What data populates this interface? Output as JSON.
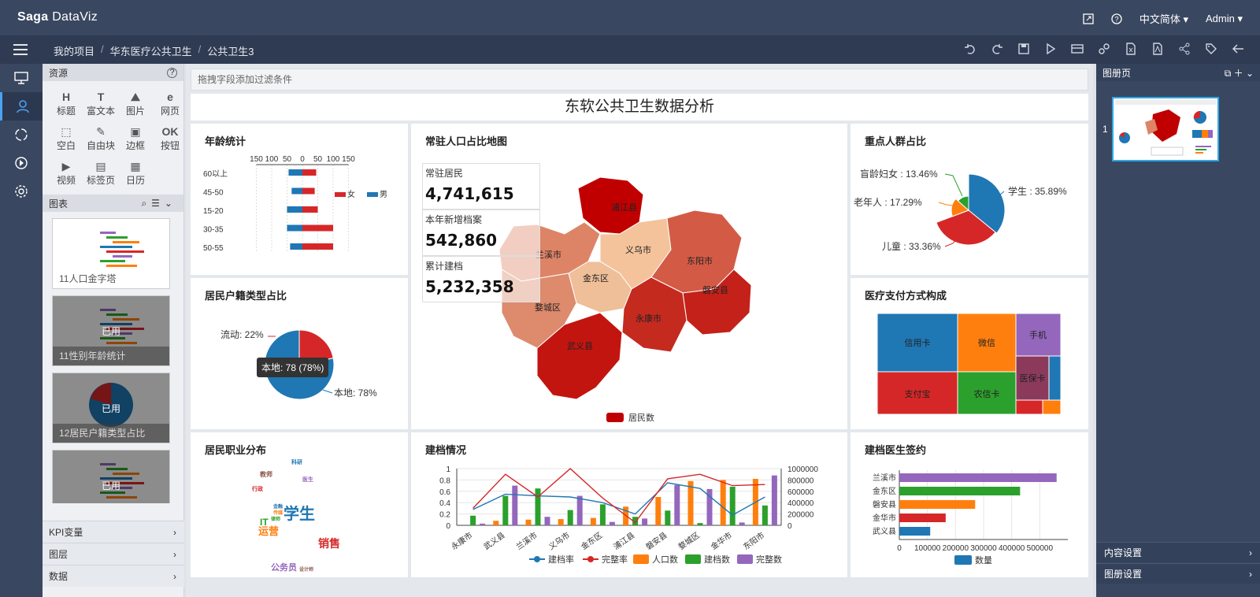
{
  "app": {
    "brand_a": "Saga",
    "brand_b": "DataViz",
    "language": "中文简体",
    "user": "Admin"
  },
  "breadcrumb": [
    "我的项目",
    "华东医疗公共卫生",
    "公共卫生3"
  ],
  "resources": {
    "title": "资源",
    "tools": [
      {
        "label": "标题",
        "glyph": "H"
      },
      {
        "label": "富文本",
        "glyph": "T"
      },
      {
        "label": "图片",
        "glyph": "⛰"
      },
      {
        "label": "网页",
        "glyph": "e"
      },
      {
        "label": "空白",
        "glyph": "⬚"
      },
      {
        "label": "自由块",
        "glyph": "✎"
      },
      {
        "label": "边框",
        "glyph": "▣"
      },
      {
        "label": "按钮",
        "glyph": "OK"
      },
      {
        "label": "视频",
        "glyph": "▶"
      },
      {
        "label": "标签页",
        "glyph": "▤"
      },
      {
        "label": "日历",
        "glyph": "▦"
      }
    ],
    "charts_title": "图表",
    "thumbs": [
      {
        "caption": "11人口金字塔",
        "used": ""
      },
      {
        "caption": "11性别年龄统计",
        "used": "已用"
      },
      {
        "caption": "12居民户籍类型占比",
        "used": "已用"
      },
      {
        "caption": "",
        "used": "已用"
      }
    ],
    "bottom": [
      "KPI变量",
      "图层",
      "数据"
    ]
  },
  "canvas": {
    "filter_placeholder": "拖拽字段添加过滤条件",
    "title": "东软公共卫生数据分析"
  },
  "cards": {
    "age": {
      "title": "年龄统计",
      "legend": [
        "女",
        "男"
      ],
      "axis": [
        "150",
        "100",
        "50",
        "0",
        "50",
        "100",
        "150"
      ]
    },
    "map": {
      "title": "常驻人口占比地图",
      "legend": "居民数"
    },
    "key": {
      "title": "重点人群占比"
    },
    "household": {
      "title": "居民户籍类型占比",
      "label_float": "流动: 22%",
      "label_local": "本地: 78%",
      "tooltip": "本地: 78 (78%)"
    },
    "payment": {
      "title": "医疗支付方式构成"
    },
    "occupation": {
      "title": "居民职业分布"
    },
    "filing": {
      "title": "建档情况"
    },
    "doctor": {
      "title": "建档医生签约",
      "legend": "数量"
    }
  },
  "kpis": [
    {
      "label": "常驻居民",
      "value": "4,741,615"
    },
    {
      "label": "本年新增档案",
      "value": "542,860"
    },
    {
      "label": "累计建档",
      "value": "5,232,358"
    }
  ],
  "map_regions": [
    "浦江县",
    "兰溪市",
    "义乌市",
    "东阳市",
    "金东区",
    "磐安县",
    "婺城区",
    "永康市",
    "武义县"
  ],
  "words": [
    {
      "t": "学生",
      "c": "#1f77b4"
    },
    {
      "t": "销售",
      "c": "#d62728"
    },
    {
      "t": "运营",
      "c": "#ff7f0e"
    },
    {
      "t": "IT",
      "c": "#2ca02c"
    },
    {
      "t": "公务员",
      "c": "#9467bd"
    },
    {
      "t": "教师",
      "c": "#8c564b"
    },
    {
      "t": "科研",
      "c": "#1f77b4"
    },
    {
      "t": "行政",
      "c": "#d62728"
    },
    {
      "t": "医生",
      "c": "#9467bd"
    },
    {
      "t": "金融",
      "c": "#1f77b4"
    },
    {
      "t": "传媒",
      "c": "#ff7f0e"
    },
    {
      "t": "律师",
      "c": "#2ca02c"
    },
    {
      "t": "设计师",
      "c": "#8c564b"
    }
  ],
  "right_panel": {
    "title": "图册页",
    "page_num": "1",
    "content_settings": "内容设置",
    "album_settings": "图册设置"
  },
  "colors": {
    "blue": "#1f77b4",
    "red": "#d62728",
    "orange": "#ff7f0e",
    "green": "#2ca02c",
    "purple": "#9467bd"
  },
  "chart_data": [
    {
      "type": "bar",
      "title": "年龄统计",
      "orientation": "horizontal-butterfly",
      "categories": [
        "60以上",
        "45-50",
        "15-20",
        "30-35",
        "50-55"
      ],
      "series": [
        {
          "name": "女",
          "values": [
            45,
            35,
            50,
            50,
            40
          ]
        },
        {
          "name": "男",
          "values": [
            45,
            40,
            50,
            100,
            100
          ]
        }
      ],
      "xlim": [
        -150,
        150
      ]
    },
    {
      "type": "pie",
      "title": "重点人群占比",
      "categories": [
        "学生",
        "儿童",
        "老年人",
        "盲龄妇女"
      ],
      "values": [
        35.89,
        33.36,
        17.29,
        13.46
      ],
      "labels": [
        "学生 : 35.89%",
        "儿童 : 33.36%",
        "老年人 : 17.29%",
        "盲龄妇女 : 13.46%"
      ]
    },
    {
      "type": "pie",
      "title": "居民户籍类型占比",
      "categories": [
        "本地",
        "流动"
      ],
      "values": [
        78,
        22
      ]
    },
    {
      "type": "heatmap",
      "title": "医疗支付方式构成",
      "categories": [
        "信用卡",
        "微信",
        "手机",
        "支付宝",
        "农信卡",
        "医保卡"
      ]
    },
    {
      "type": "bar",
      "title": "建档情况",
      "categories": [
        "永康市",
        "武义县",
        "兰溪市",
        "义乌市",
        "金东区",
        "浦江县",
        "磐安县",
        "婺城区",
        "金华市",
        "东阳市"
      ],
      "series": [
        {
          "name": "建档率",
          "kind": "line",
          "values": [
            0.28,
            0.55,
            0.52,
            0.5,
            0.4,
            0.2,
            0.75,
            0.65,
            0.18,
            0.5
          ]
        },
        {
          "name": "完整率",
          "kind": "line",
          "values": [
            0.3,
            0.9,
            0.5,
            1.0,
            0.48,
            0.05,
            0.82,
            0.9,
            0.7,
            0.72
          ]
        },
        {
          "name": "人口数",
          "kind": "bar",
          "values": [
            0,
            80000,
            100000,
            110000,
            130000,
            330000,
            500000,
            780000,
            800000,
            820000
          ]
        },
        {
          "name": "建档数",
          "kind": "bar",
          "values": [
            170000,
            520000,
            650000,
            270000,
            370000,
            150000,
            260000,
            40000,
            680000,
            350000
          ]
        },
        {
          "name": "完整数",
          "kind": "bar",
          "values": [
            30000,
            700000,
            150000,
            520000,
            60000,
            120000,
            710000,
            640000,
            50000,
            880000
          ]
        }
      ],
      "y_left_ticks": [
        "0",
        "0.2",
        "0.4",
        "0.6",
        "0.8",
        "1"
      ],
      "y_right_ticks": [
        "0",
        "200000",
        "400000",
        "600000",
        "800000",
        "1000000"
      ]
    },
    {
      "type": "bar",
      "title": "建档医生签约",
      "orientation": "horizontal",
      "categories": [
        "兰溪市",
        "金东区",
        "磐安县",
        "金华市",
        "武义县"
      ],
      "values": [
        560000,
        430000,
        270000,
        165000,
        110000
      ],
      "x_ticks": [
        "0",
        "100000",
        "200000",
        "300000",
        "400000",
        "500000"
      ]
    }
  ]
}
